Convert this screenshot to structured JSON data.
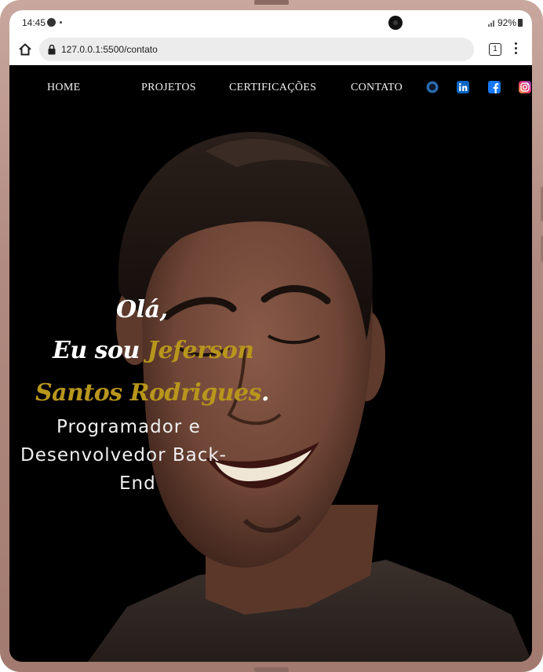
{
  "status_bar": {
    "time": "14:45",
    "battery": "92%"
  },
  "browser": {
    "url": "127.0.0.1:5500/contato",
    "tab_count": "1"
  },
  "nav": {
    "items": [
      {
        "label": "HOME"
      },
      {
        "label": "PROJETOS"
      },
      {
        "label": "CERTIFICAÇÕES"
      },
      {
        "label": "CONTATO"
      }
    ],
    "social": [
      {
        "name": "github-icon",
        "color": "#2b6cb0"
      },
      {
        "name": "linkedin-icon",
        "color": "#0a66c2"
      },
      {
        "name": "facebook-icon",
        "color": "#1877f2"
      },
      {
        "name": "instagram-icon",
        "color": "#e1306c"
      }
    ]
  },
  "hero": {
    "greeting": "Olá,",
    "intro_prefix": "Eu sou",
    "name_first": "Jeferson",
    "name_rest": "Santos Rodrigues",
    "period": ".",
    "subtitle_line1": "Programador e",
    "subtitle_line2": "Desenvolvedor Back-",
    "subtitle_line3": "End"
  },
  "colors": {
    "accent_gold": "#b8961c",
    "background": "#000000",
    "text": "#ffffff"
  }
}
